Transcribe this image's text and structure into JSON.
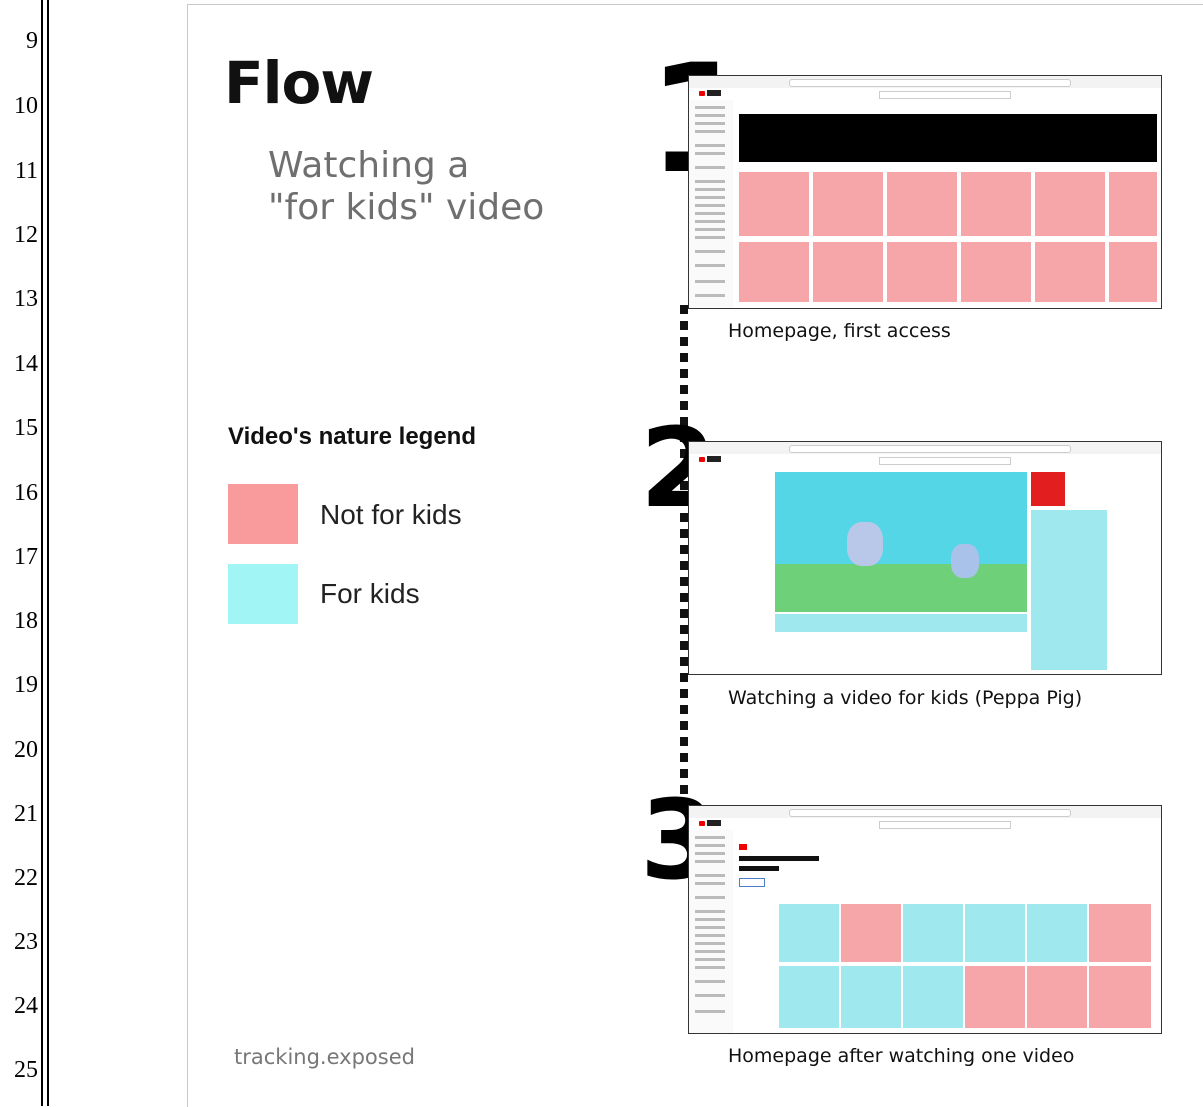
{
  "gutter": {
    "line_numbers": [
      "9",
      "10",
      "11",
      "12",
      "13",
      "14",
      "15",
      "16",
      "17",
      "18",
      "19",
      "20",
      "21",
      "22",
      "23",
      "24",
      "25"
    ]
  },
  "slide": {
    "title": "Flow",
    "subtitle": "Watching a\n\"for kids\" video",
    "legend": {
      "title": "Video's nature legend",
      "items": [
        {
          "label": "Not for kids",
          "color": "#f99a9c"
        },
        {
          "label": "For kids",
          "color": "#a1f5f4"
        }
      ]
    },
    "footer": "tracking.exposed",
    "steps": [
      {
        "number": "1",
        "caption": "Homepage, first access"
      },
      {
        "number": "2",
        "caption": "Watching a video for kids (Peppa Pig)"
      },
      {
        "number": "3",
        "caption": "Homepage after watching one video"
      }
    ]
  }
}
